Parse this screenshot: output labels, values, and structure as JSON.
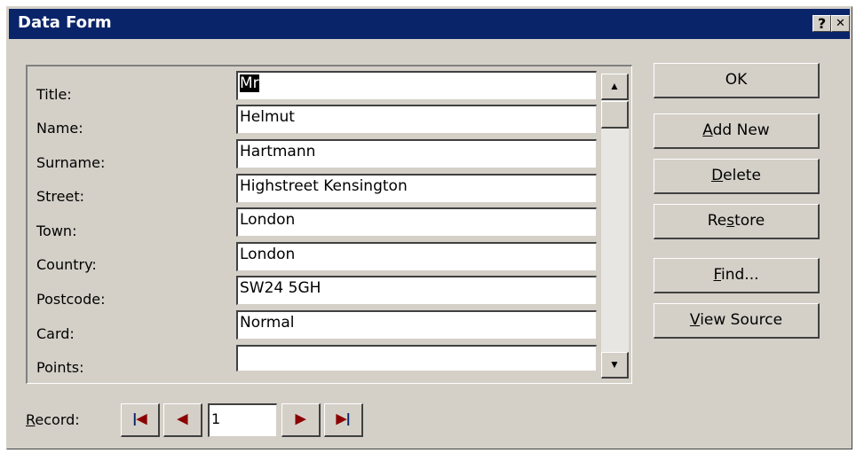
{
  "window": {
    "title": "Data Form",
    "help_label": "?",
    "close_label": "✕"
  },
  "fields": [
    {
      "label": "Title:",
      "value": "Mr"
    },
    {
      "label": "Name:",
      "value": "Helmut"
    },
    {
      "label": "Surname:",
      "value": "Hartmann"
    },
    {
      "label": "Street:",
      "value": "Highstreet Kensington"
    },
    {
      "label": "Town:",
      "value": "London"
    },
    {
      "label": "Country:",
      "value": "London"
    },
    {
      "label": "Postcode:",
      "value": "SW24 5GH"
    },
    {
      "label": "Card:",
      "value": "Normal"
    },
    {
      "label": "Points:",
      "value": ""
    }
  ],
  "buttons": {
    "ok": {
      "pre": "OK",
      "key": "",
      "post": ""
    },
    "add_new": {
      "pre": "",
      "key": "A",
      "post": "dd New"
    },
    "delete": {
      "pre": "",
      "key": "D",
      "post": "elete"
    },
    "restore": {
      "pre": "Re",
      "key": "s",
      "post": "tore"
    },
    "find": {
      "pre": "",
      "key": "F",
      "post": "ind..."
    },
    "view_source": {
      "pre": "",
      "key": "V",
      "post": "iew Source"
    }
  },
  "record": {
    "label_key": "R",
    "label_rest": "ecord:",
    "value": "1"
  },
  "icons": {
    "first": "first-record-icon",
    "prev": "previous-record-icon",
    "next": "next-record-icon",
    "last": "last-record-icon",
    "scroll_up": "scroll-up-arrow-icon",
    "scroll_down": "scroll-down-arrow-icon"
  }
}
